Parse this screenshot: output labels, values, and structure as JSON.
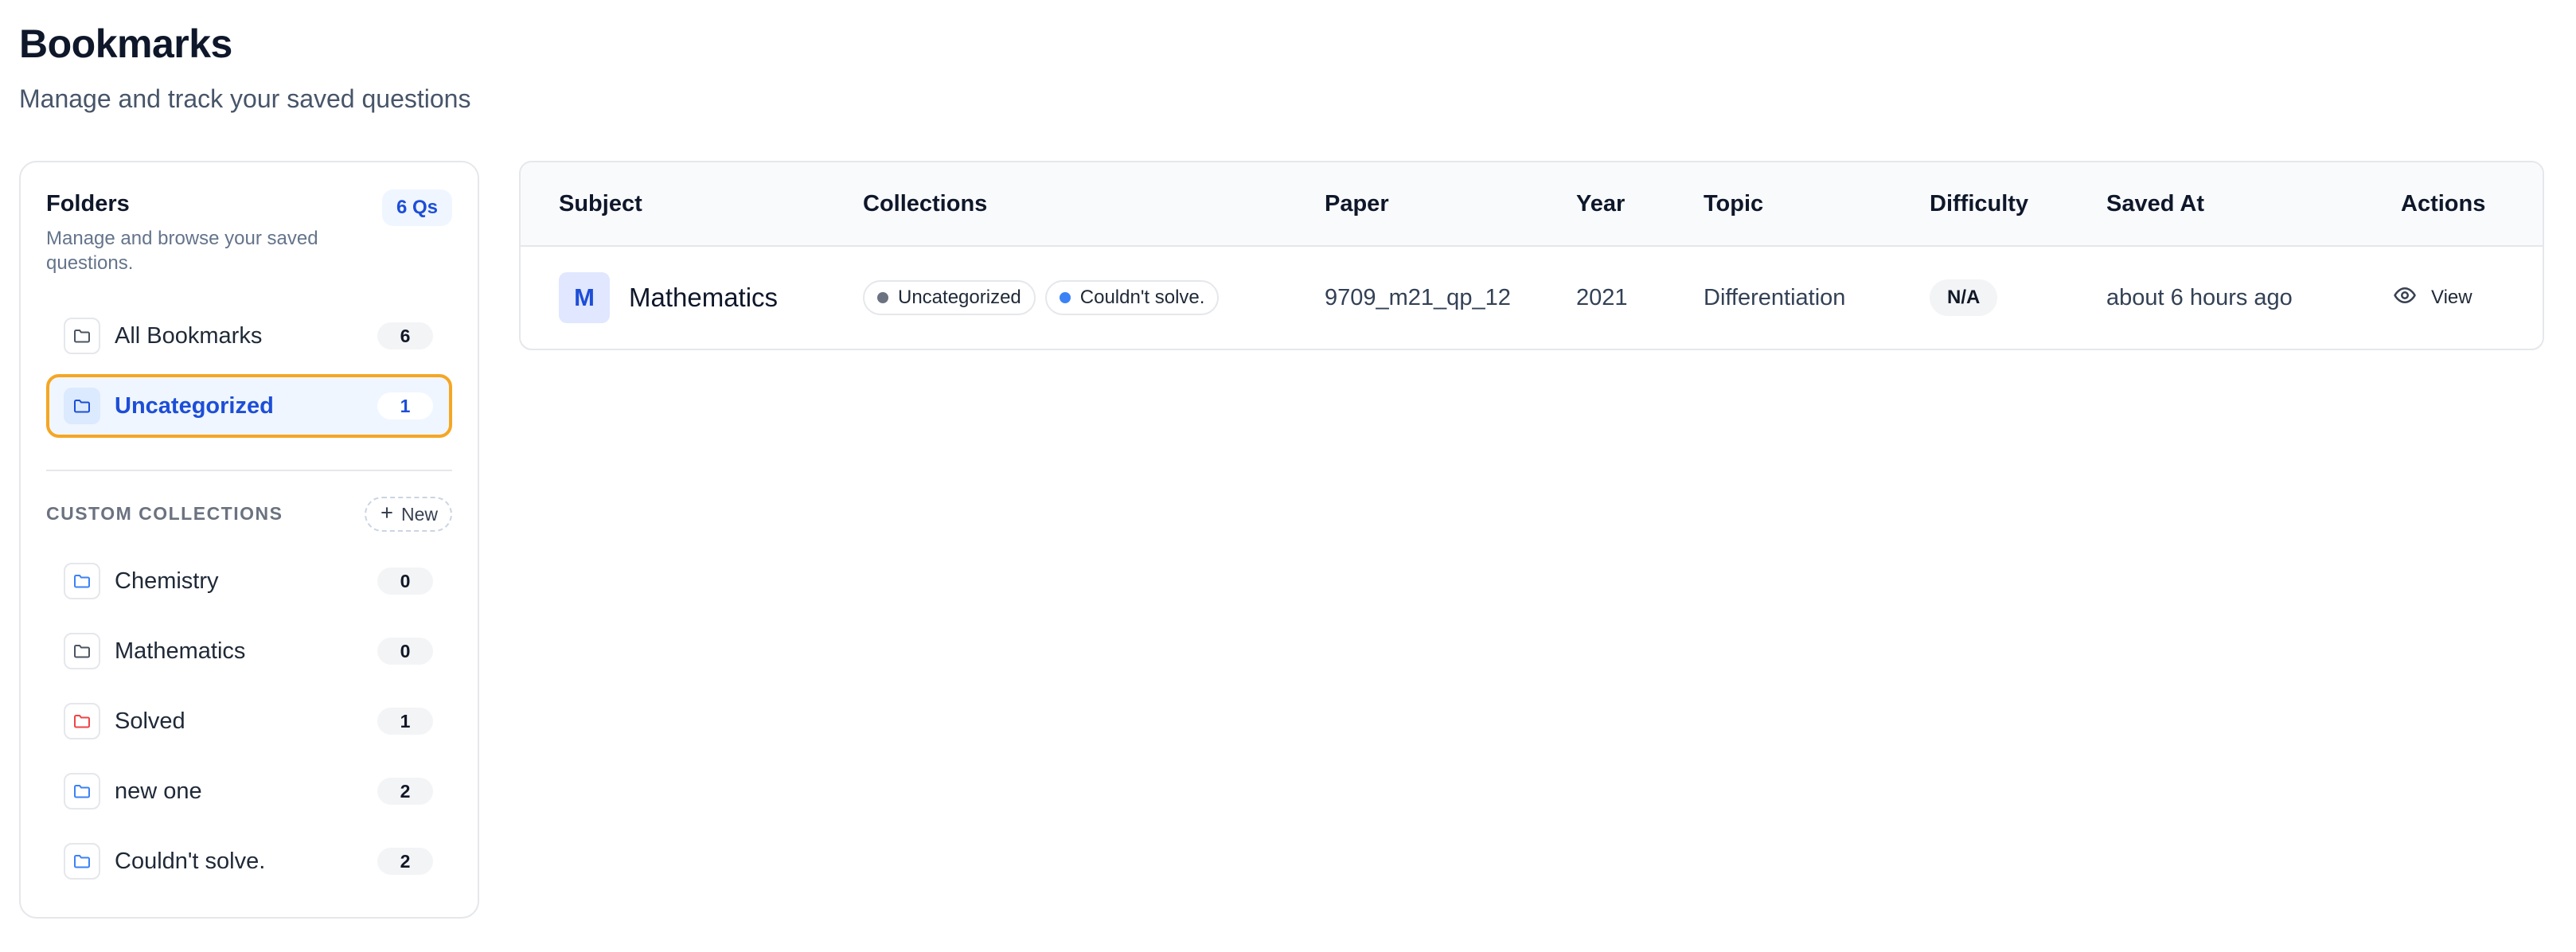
{
  "page": {
    "title": "Bookmarks",
    "subtitle": "Manage and track your saved questions"
  },
  "folders": {
    "title": "Folders",
    "description": "Manage and browse your saved questions.",
    "qs_badge": "6 Qs",
    "main_items": [
      {
        "label": "All Bookmarks",
        "count": "6",
        "icon": "folder-icon",
        "icon_color": "#4b5563",
        "active": false
      },
      {
        "label": "Uncategorized",
        "count": "1",
        "icon": "folder-icon",
        "icon_color": "#1d4ed8",
        "active": true
      }
    ],
    "custom_section_label": "CUSTOM COLLECTIONS",
    "new_label": "New",
    "collections": [
      {
        "label": "Chemistry",
        "count": "0",
        "icon": "folder-icon",
        "icon_color": "#3b82f6"
      },
      {
        "label": "Mathematics",
        "count": "0",
        "icon": "folder-icon",
        "icon_color": "#4b5563"
      },
      {
        "label": "Solved",
        "count": "1",
        "icon": "folder-icon",
        "icon_color": "#ef4444"
      },
      {
        "label": "new one",
        "count": "2",
        "icon": "folder-icon",
        "icon_color": "#3b82f6"
      },
      {
        "label": "Couldn't solve.",
        "count": "2",
        "icon": "folder-icon",
        "icon_color": "#3b82f6"
      }
    ]
  },
  "table": {
    "columns": [
      "Subject",
      "Collections",
      "Paper",
      "Year",
      "Topic",
      "Difficulty",
      "Saved At",
      "Actions"
    ],
    "rows": [
      {
        "subject_initial": "M",
        "subject": "Mathematics",
        "collections": [
          {
            "label": "Uncategorized",
            "dot_color": "#6b7280"
          },
          {
            "label": "Couldn't solve.",
            "dot_color": "#3b82f6"
          }
        ],
        "paper": "9709_m21_qp_12",
        "year": "2021",
        "topic": "Differentiation",
        "difficulty": "N/A",
        "saved_at": "about 6 hours ago",
        "action_label": "View",
        "action_icon": "eye-icon"
      }
    ]
  }
}
